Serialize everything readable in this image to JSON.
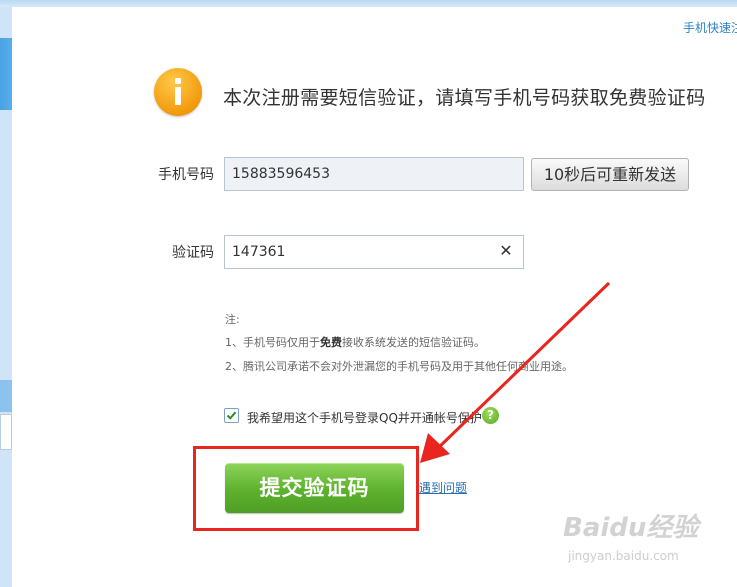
{
  "header": {
    "top_link": "手机快速注"
  },
  "main": {
    "headline": "本次注册需要短信验证，请填写手机号码获取免费验证码",
    "phone_label": "手机号码",
    "phone_value": "15883596453",
    "resend_label": "10秒后可重新发送",
    "code_label": "验证码",
    "code_value": "147361",
    "clear_symbol": "✕"
  },
  "notes": {
    "title": "注:",
    "item1_prefix": "1、手机号码仅用于",
    "item1_bold": "免费",
    "item1_suffix": "接收系统发送的短信验证码。",
    "item2": "2、腾讯公司承诺不会对外泄漏您的手机号码及用于其他任何商业用途。"
  },
  "options": {
    "checkbox_checked": true,
    "checkbox_label": "我希望用这个手机号登录QQ并开通帐号保护",
    "help_symbol": "?"
  },
  "actions": {
    "submit_label": "提交验证码",
    "problem_link": "遇到问题"
  },
  "watermark": {
    "brand": "Baidu经验",
    "url": "jingyan.baidu.com"
  },
  "colors": {
    "accent_blue": "#4aa3e6",
    "submit_green": "#5cb12d",
    "annotation_red": "#e8251e",
    "info_orange": "#f29a0c"
  },
  "icons": [
    "info-icon",
    "clear-icon",
    "check-icon",
    "help-icon",
    "annotation-arrow"
  ]
}
